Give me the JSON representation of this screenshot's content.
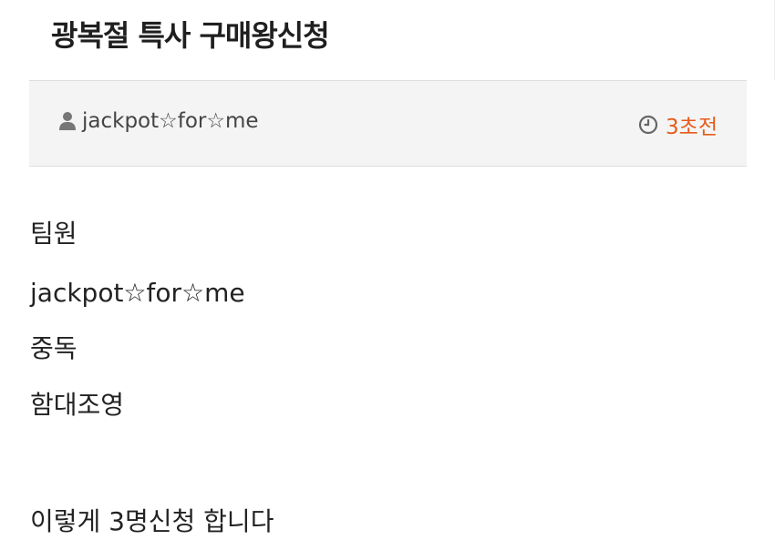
{
  "post": {
    "title": "광복절 특사 구매왕신청",
    "author": "jackpot☆for☆me",
    "time_ago": "3초전",
    "body_lines": [
      "팀원",
      "jackpot☆for☆me",
      "중독",
      "함대조영",
      "이렇게 3명신청 합니다"
    ]
  },
  "icons": {
    "author": "user-icon",
    "time": "clock-icon"
  },
  "colors": {
    "accent": "#e65b1a",
    "meta_background": "#f4f4f4",
    "text": "#222222"
  }
}
